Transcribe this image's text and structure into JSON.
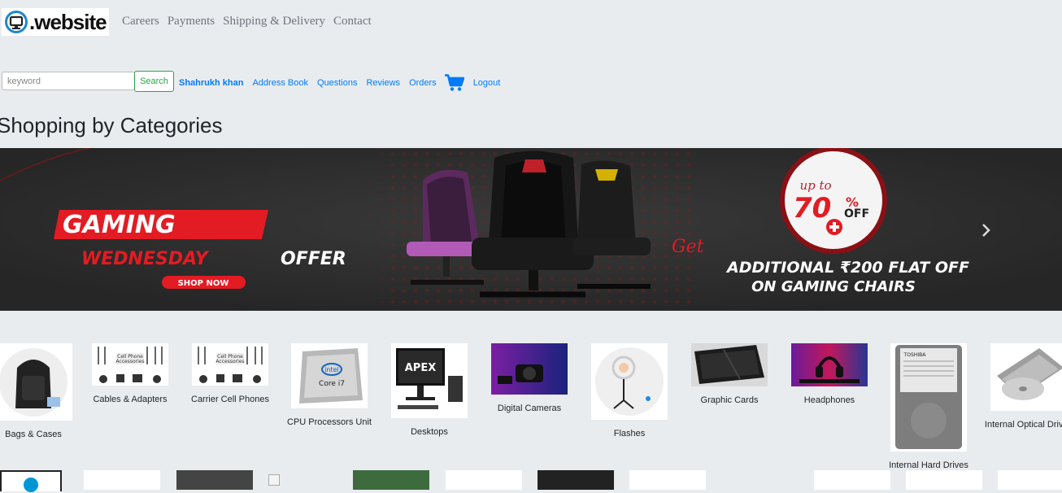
{
  "header": {
    "logo_text": ".website",
    "nav": [
      "Careers",
      "Payments",
      "Shipping & Delivery",
      "Contact"
    ]
  },
  "search": {
    "placeholder": "keyword",
    "button_label": "Search"
  },
  "user_nav": {
    "username": "Shahrukh khan",
    "links": [
      "Address Book",
      "Questions",
      "Reviews",
      "Orders"
    ],
    "cart_icon": "shopping-cart-icon",
    "logout": "Logout"
  },
  "page_title": "Shopping by Categories",
  "banner": {
    "line1": "GAMING",
    "line2a": "WEDNESDAY",
    "line2b": "OFFER",
    "cta": "SHOP NOW",
    "badge_top": "up to",
    "badge_pct": "70",
    "badge_pct_sign": "%",
    "badge_off": "OFF",
    "get": "Get",
    "promo1": "ADDITIONAL ₹200 FLAT OFF",
    "promo2": "ON GAMING CHAIRS",
    "next_icon": "chevron-right-icon"
  },
  "categories": [
    {
      "label": "Bags & Cases"
    },
    {
      "label": "Cables & Adapters"
    },
    {
      "label": "Carrier Cell Phones"
    },
    {
      "label": "CPU Processors Unit"
    },
    {
      "label": "Desktops"
    },
    {
      "label": "Digital Cameras"
    },
    {
      "label": "Flashes"
    },
    {
      "label": "Graphic Cards"
    },
    {
      "label": "Headphones"
    },
    {
      "label": "Internal Hard Drives"
    },
    {
      "label": "Internal Optical Drives"
    }
  ],
  "colors": {
    "background": "#e9ecef",
    "link": "#007bff",
    "search_button": "#28a745",
    "banner_red": "#e31b23"
  }
}
